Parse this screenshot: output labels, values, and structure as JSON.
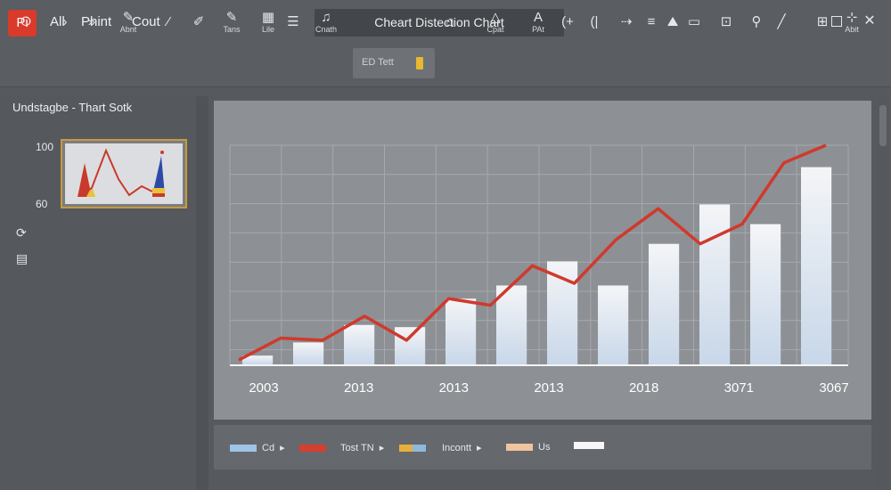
{
  "app": {
    "logo_text": "Pi",
    "menu": [
      "All",
      "Phint",
      "Cout"
    ],
    "window_title": "Cheart Distection Chart"
  },
  "window_controls": {
    "close": "✕"
  },
  "toolbar": {
    "items": [
      {
        "glyph": "⭘",
        "label": ""
      },
      {
        "glyph": "›",
        "label": ""
      },
      {
        "glyph": "»",
        "label": ""
      },
      {
        "glyph": "✎",
        "label": "Abnt"
      },
      {
        "glyph": "⁄",
        "label": ""
      },
      {
        "glyph": "✐",
        "label": ""
      },
      {
        "glyph": "✎",
        "label": "Tans"
      },
      {
        "glyph": "▦",
        "label": "Lile"
      },
      {
        "glyph": "☰",
        "label": ""
      },
      {
        "glyph": "♫",
        "label": "Cnath"
      },
      {
        "glyph": "⌂",
        "label": ""
      },
      {
        "glyph": "△",
        "label": "Cpat"
      },
      {
        "glyph": "A",
        "label": "PAt"
      },
      {
        "glyph": "(+",
        "label": ""
      },
      {
        "glyph": "(|",
        "label": ""
      },
      {
        "glyph": "⇢",
        "label": ""
      },
      {
        "glyph": "≡",
        "label": ""
      },
      {
        "glyph": "⛰",
        "label": ""
      },
      {
        "glyph": "▭",
        "label": ""
      },
      {
        "glyph": "⊡",
        "label": ""
      },
      {
        "glyph": "⚲",
        "label": ""
      },
      {
        "glyph": "╱",
        "label": ""
      },
      {
        "glyph": "⊞",
        "label": ""
      },
      {
        "glyph": "⊹",
        "label": "Abit"
      }
    ],
    "field_text": "ED Tett"
  },
  "left_panel": {
    "title": "Undstagbe - Thart Sotk",
    "axis_top": "100",
    "axis_bottom": "60",
    "icons": [
      "refresh-icon",
      "table-icon"
    ]
  },
  "colors": {
    "line": "#d0392c",
    "bar_top": "#f4f5f7",
    "bar_bottom": "#c8d7e9",
    "grid": "#a6a9ad",
    "canvas": "#8d9094"
  },
  "chart_data": {
    "type": "bar",
    "x_labels": [
      "2003",
      "2013",
      "2013",
      "2013",
      "2018",
      "3071",
      "3067"
    ],
    "bar_values": [
      4,
      10,
      18,
      17,
      30,
      36,
      47,
      36,
      55,
      73,
      64,
      90
    ],
    "line_values": [
      2,
      12,
      11,
      22,
      11,
      30,
      27,
      45,
      37,
      57,
      71,
      55,
      64,
      92,
      100
    ],
    "ylim": [
      0,
      100
    ],
    "grid": true
  },
  "legend": [
    {
      "label": "Cd",
      "color": "#9fc4e6",
      "arrow": "▸"
    },
    {
      "label": "Tost TN",
      "color": "#d44030",
      "arrow": "▸"
    },
    {
      "label": "Incontt",
      "color": "#e6b03a",
      "color2": "#8fb8dc",
      "arrow": "▸"
    },
    {
      "label": "Us",
      "color": "#f0c4a0",
      "arrow": ""
    },
    {
      "label": "",
      "color": "#f7f7f7",
      "arrow": ""
    }
  ]
}
